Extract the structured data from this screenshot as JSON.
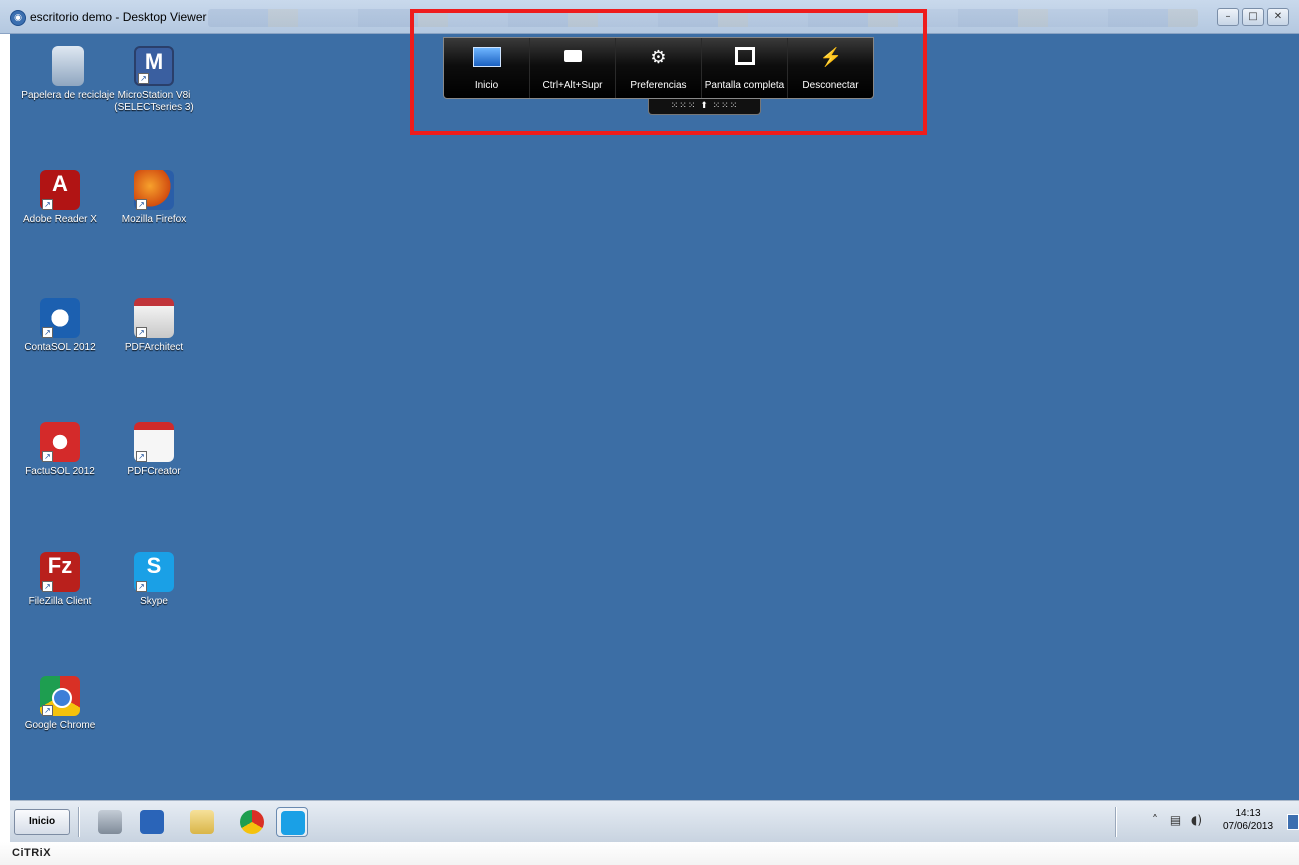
{
  "window": {
    "title": "escritorio demo - Desktop Viewer",
    "buttons": {
      "minimize": "–",
      "restore": "□",
      "close": "✕"
    }
  },
  "desktop_icons": [
    {
      "label": "Papelera de reciclaje",
      "icon": "recycle-bin-icon"
    },
    {
      "label": "MicroStation V8i (SELECTseries 3)",
      "icon": "microstation-icon"
    },
    {
      "label": "Adobe Reader X",
      "icon": "adobe-reader-icon"
    },
    {
      "label": "Mozilla Firefox",
      "icon": "firefox-icon"
    },
    {
      "label": "ContaSOL 2012",
      "icon": "contasol-icon"
    },
    {
      "label": "PDFArchitect",
      "icon": "pdfarchitect-icon"
    },
    {
      "label": "FactuSOL 2012",
      "icon": "factusol-icon"
    },
    {
      "label": "PDFCreator",
      "icon": "pdfcreator-icon"
    },
    {
      "label": "FileZilla Client",
      "icon": "filezilla-icon"
    },
    {
      "label": "Skype",
      "icon": "skype-icon"
    },
    {
      "label": "Google Chrome",
      "icon": "chrome-icon"
    }
  ],
  "citrix_toolbar": {
    "buttons": [
      {
        "label": "Inicio",
        "icon": "windows-start-icon"
      },
      {
        "label": "Ctrl+Alt+Supr",
        "icon": "keyboard-icon"
      },
      {
        "label": "Preferencias",
        "icon": "gears-icon"
      },
      {
        "label": "Pantalla completa",
        "icon": "fullscreen-icon"
      },
      {
        "label": "Desconectar",
        "icon": "disconnect-plug-icon"
      }
    ],
    "grip": "⁙⁙⁙ ⬆ ⁙⁙⁙"
  },
  "taskbar": {
    "start_label": "Inicio",
    "pinned": [
      "server-manager-icon",
      "powershell-icon",
      "explorer-icon",
      "chrome-icon",
      "skype-icon"
    ],
    "tray_chevron": "˄",
    "time": "14:13",
    "date": "07/06/2013"
  },
  "footer": {
    "brand": "CiTRiX"
  },
  "colors": {
    "desktop_bg": "#3c6ea5",
    "highlight": "#ee1c1c"
  }
}
